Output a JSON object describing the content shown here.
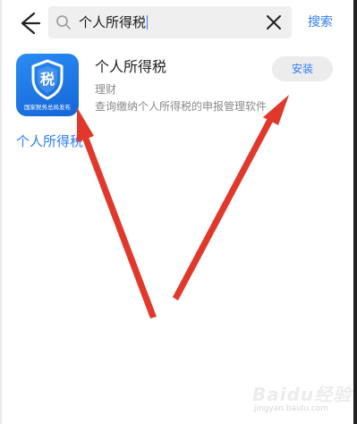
{
  "search": {
    "query": "个人所得税",
    "action_label": "搜索"
  },
  "app": {
    "name": "个人所得税",
    "category": "理财",
    "description": "查询缴纳个人所得税的申报管理软件",
    "icon_glyph": "税",
    "icon_caption": "国家税务总局发布",
    "install_label": "安装"
  },
  "suggestion": {
    "label": "个人所得税"
  },
  "colors": {
    "accent": "#2f7df7",
    "arrow": "#e0392b",
    "icon_bg": "#1f76e6"
  },
  "watermark": {
    "text": "Baidu经验",
    "sub": "jingyan.baidu.com"
  }
}
